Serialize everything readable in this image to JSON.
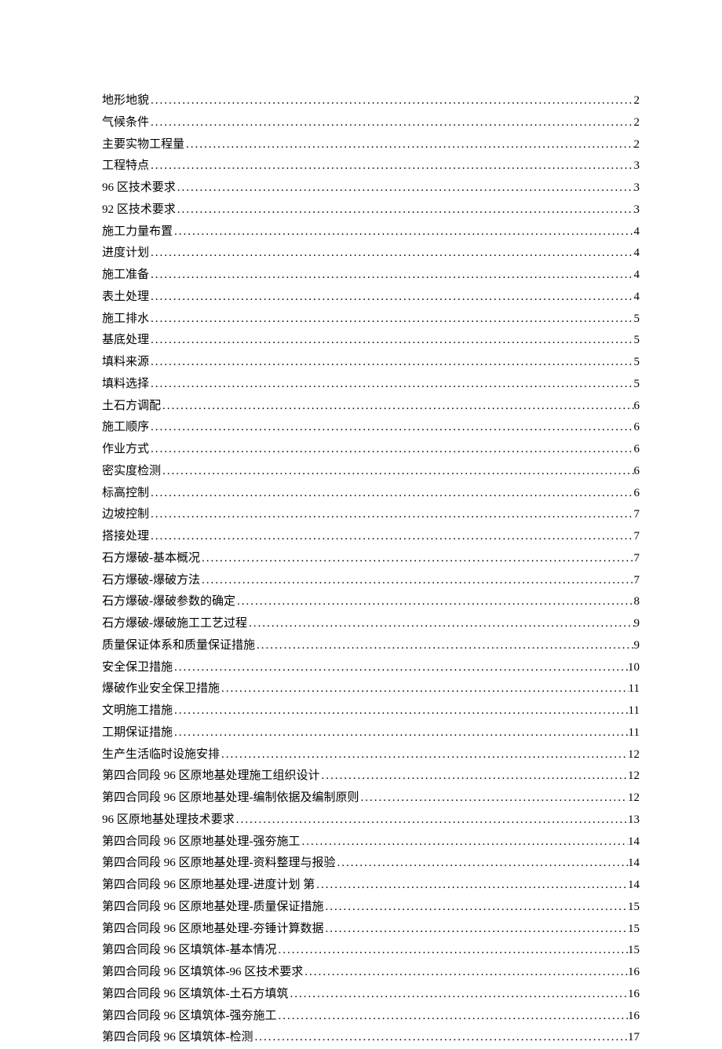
{
  "toc": {
    "entries": [
      {
        "title": "地形地貌",
        "page": "2"
      },
      {
        "title": "气候条件",
        "page": "2"
      },
      {
        "title": "主要实物工程量",
        "page": "2"
      },
      {
        "title": "工程特点",
        "page": "3"
      },
      {
        "title": "96 区技术要求",
        "page": "3"
      },
      {
        "title": "92 区技术要求",
        "page": "3"
      },
      {
        "title": "施工力量布置",
        "page": "4"
      },
      {
        "title": "进度计划",
        "page": "4"
      },
      {
        "title": "施工准备",
        "page": "4"
      },
      {
        "title": "表土处理",
        "page": "4"
      },
      {
        "title": "施工排水",
        "page": "5"
      },
      {
        "title": "基底处理",
        "page": "5"
      },
      {
        "title": "填料来源",
        "page": "5"
      },
      {
        "title": "填料选择",
        "page": "5"
      },
      {
        "title": "土石方调配",
        "page": "6"
      },
      {
        "title": "施工顺序",
        "page": "6"
      },
      {
        "title": "作业方式",
        "page": "6"
      },
      {
        "title": "密实度检测",
        "page": "6"
      },
      {
        "title": "标高控制",
        "page": "6"
      },
      {
        "title": "边坡控制",
        "page": "7"
      },
      {
        "title": "搭接处理",
        "page": "7"
      },
      {
        "title": "石方爆破-基本概况",
        "page": "7"
      },
      {
        "title": "石方爆破-爆破方法",
        "page": "7"
      },
      {
        "title": "石方爆破-爆破参数的确定",
        "page": "8"
      },
      {
        "title": "石方爆破-爆破施工工艺过程",
        "page": "9"
      },
      {
        "title": "质量保证体系和质量保证措施",
        "page": "9"
      },
      {
        "title": "安全保卫措施",
        "page": "10"
      },
      {
        "title": "爆破作业安全保卫措施",
        "page": "11"
      },
      {
        "title": "文明施工措施",
        "page": "11"
      },
      {
        "title": "工期保证措施",
        "page": "11"
      },
      {
        "title": "生产生活临时设施安排",
        "page": "12"
      },
      {
        "title": "第四合同段 96 区原地基处理施工组织设计",
        "page": "12"
      },
      {
        "title": "第四合同段 96 区原地基处理-编制依据及编制原则",
        "page": "12"
      },
      {
        "title": "96 区原地基处理技术要求",
        "page": "13"
      },
      {
        "title": "第四合同段 96 区原地基处理-强夯施工",
        "page": "14"
      },
      {
        "title": "第四合同段 96 区原地基处理-资料整理与报验",
        "page": "14"
      },
      {
        "title": "第四合同段 96 区原地基处理-进度计划   第",
        "page": "14"
      },
      {
        "title": "第四合同段 96 区原地基处理-质量保证措施",
        "page": "15"
      },
      {
        "title": "第四合同段 96 区原地基处理-夯锤计算数据",
        "page": "15"
      },
      {
        "title": "第四合同段 96 区填筑体-基本情况",
        "page": "15"
      },
      {
        "title": "第四合同段 96 区填筑体-96 区技术要求",
        "page": "16"
      },
      {
        "title": "第四合同段 96 区填筑体-土石方填筑",
        "page": "16"
      },
      {
        "title": "第四合同段 96 区填筑体-强夯施工",
        "page": "16"
      },
      {
        "title": "第四合同段 96 区填筑体-检测",
        "page": "17"
      }
    ]
  }
}
